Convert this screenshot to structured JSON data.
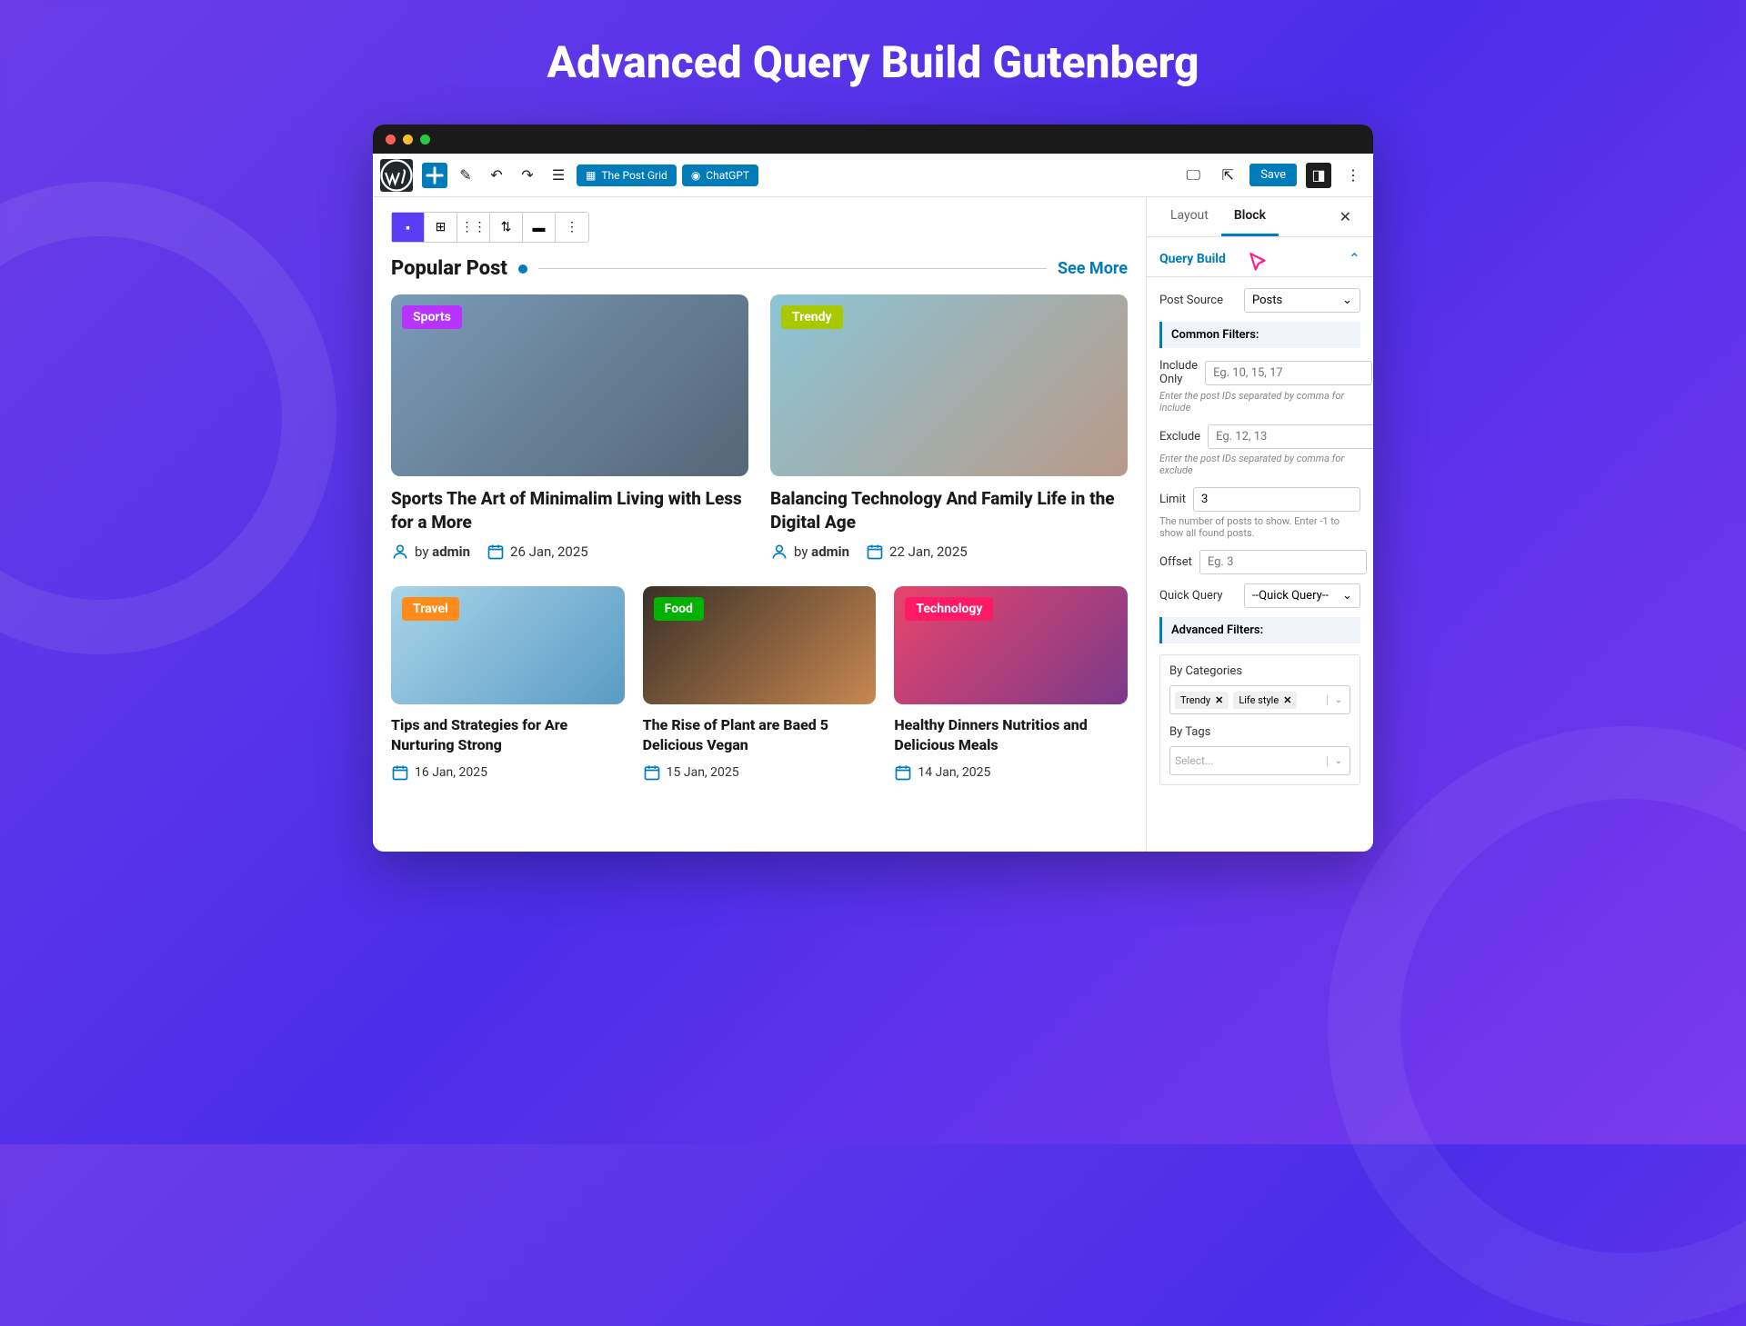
{
  "page_heading": "Advanced Query Build Gutenberg",
  "toolbar": {
    "post_grid_label": "The Post Grid",
    "chatgpt_label": "ChatGPT",
    "save_label": "Save"
  },
  "section": {
    "title": "Popular Post",
    "see_more": "See More"
  },
  "posts_top": [
    {
      "tag": "Sports",
      "tag_class": "sports",
      "title": "Sports The Art of Minimalim Living with Less for a More",
      "author": "admin",
      "date": "26 Jan, 2025"
    },
    {
      "tag": "Trendy",
      "tag_class": "trendy",
      "title": "Balancing Technology And Family Life in the Digital Age",
      "author": "admin",
      "date": "22 Jan, 2025"
    }
  ],
  "posts_bot": [
    {
      "tag": "Travel",
      "tag_class": "travel",
      "title": "Tips and Strategies for Are Nurturing Strong",
      "date": "16 Jan, 2025"
    },
    {
      "tag": "Food",
      "tag_class": "food",
      "title": "The Rise of Plant are Baed 5 Delicious Vegan",
      "date": "15 Jan, 2025"
    },
    {
      "tag": "Technology",
      "tag_class": "tech",
      "title": "Healthy Dinners Nutritios and Delicious Meals",
      "date": "14 Jan, 2025"
    }
  ],
  "sidebar": {
    "tabs": {
      "layout": "Layout",
      "block": "Block"
    },
    "panel_title": "Query Build",
    "post_source": {
      "label": "Post Source",
      "value": "Posts"
    },
    "common_filters": "Common Filters:",
    "include": {
      "label": "Include Only",
      "placeholder": "Eg. 10, 15, 17",
      "help": "Enter the post IDs separated by comma for include"
    },
    "exclude": {
      "label": "Exclude",
      "placeholder": "Eg. 12, 13",
      "help": "Enter the post IDs separated by comma for exclude"
    },
    "limit": {
      "label": "Limit",
      "value": "3",
      "help": "The number of posts to show. Enter -1 to show all found posts."
    },
    "offset": {
      "label": "Offset",
      "placeholder": "Eg. 3"
    },
    "quick_query": {
      "label": "Quick Query",
      "value": "--Quick Query--"
    },
    "advanced_filters": "Advanced Filters:",
    "by_categories": {
      "label": "By Categories",
      "chips": [
        "Trendy",
        "Life style"
      ]
    },
    "by_tags": {
      "label": "By Tags",
      "placeholder": "Select..."
    }
  }
}
